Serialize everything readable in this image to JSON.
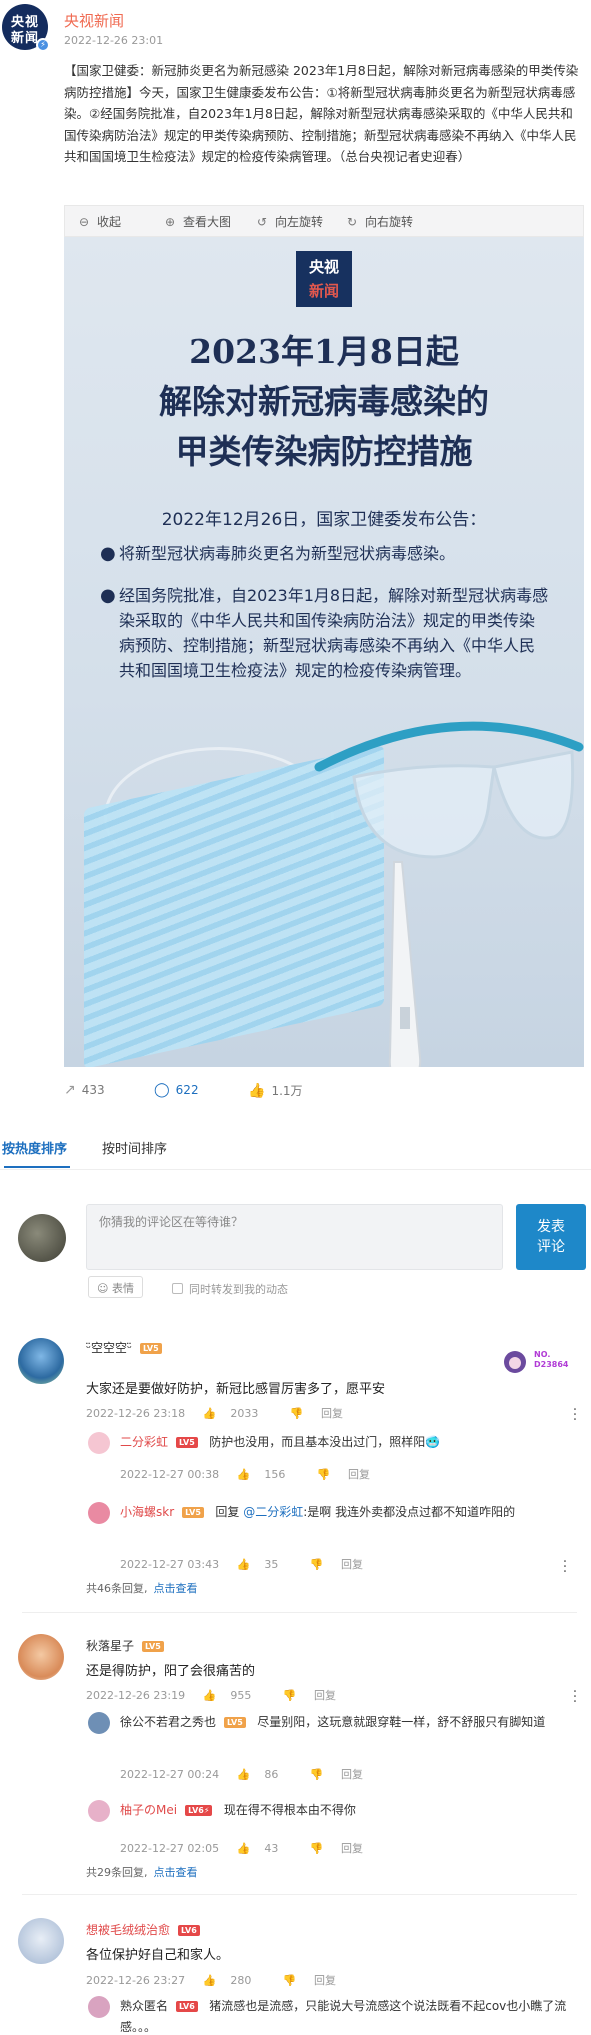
{
  "post": {
    "avatar_text_1": "央视",
    "avatar_text_2": "新闻",
    "author": "央视新闻",
    "time": "2022-12-26 23:01",
    "text": "【国家卫健委：新冠肺炎更名为新冠感染 2023年1月8日起，解除对新冠病毒感染的甲类传染病防控措施】今天，国家卫生健康委发布公告：①将新型冠状病毒肺炎更名为新型冠状病毒感染。②经国务院批准，自2023年1月8日起，解除对新型冠状病毒感染采取的《中华人民共和国传染病防治法》规定的甲类传染病预防、控制措施；新型冠状病毒感染不再纳入《中华人民共和国国境卫生检疫法》规定的检疫传染病管理。（总台央视记者史迎春）"
  },
  "viewer": {
    "collapse": "收起",
    "view_large": "查看大图",
    "rotate_left": "向左旋转",
    "rotate_right": "向右旋转"
  },
  "poster": {
    "logo_1": "央视",
    "logo_2": "新闻",
    "title_1": "2023年1月8日起",
    "title_2": "解除对新冠病毒感染的",
    "title_3": "甲类传染病防控措施",
    "subtitle": "2022年12月26日，国家卫健委发布公告：",
    "bullet_1": "将新型冠状病毒肺炎更名为新型冠状病毒感染。",
    "bullet_2": "经国务院批准，自2023年1月8日起，解除对新型冠状病毒感染采取的《中华人民共和国传染病防治法》规定的甲类传染病预防、控制措施；新型冠状病毒感染不再纳入《中华人民共和国国境卫生检疫法》规定的检疫传染病管理。"
  },
  "actions": {
    "reposts": "433",
    "comments": "622",
    "likes": "1.1万"
  },
  "sort": {
    "hot": "按热度排序",
    "time": "按时间排序"
  },
  "compose": {
    "placeholder": "你猜我的评论区在等待谁？",
    "post_line1": "发表",
    "post_line2": "评论",
    "emoji": "表情",
    "repost": "同时转发到我的动态"
  },
  "comments": [
    {
      "user": "ᵕ̈空空空ᵕ̈",
      "level": "LV5",
      "fan_badge": "NO.\nD23864",
      "text": "大家还是要做好防护，新冠比感冒厉害多了，愿平安",
      "time": "2022-12-26 23:18",
      "likes": "2033",
      "reply": "回复",
      "replies": [
        {
          "user": "二分彩虹",
          "level": "LV5",
          "text": "防护也没用，而且基本没出过门，照样阳🥶",
          "time": "2022-12-27 00:38",
          "likes": "156",
          "reply": "回复"
        },
        {
          "user": "小海螺skr",
          "level": "LV5",
          "reply_prefix": "回复",
          "mention": "@二分彩虹",
          "text": ":是啊  我连外卖都没点过都不知道咋阳的",
          "time": "2022-12-27 03:43",
          "likes": "35",
          "reply": "回复"
        }
      ],
      "more_count": "共46条回复,",
      "more_link": "点击查看"
    },
    {
      "user": "秋落星子",
      "level": "LV5",
      "text": "还是得防护，阳了会很痛苦的",
      "time": "2022-12-26 23:19",
      "likes": "955",
      "reply": "回复",
      "replies": [
        {
          "user": "徐公不若君之秀也",
          "level": "LV5",
          "text": "尽量别阳，这玩意就跟穿鞋一样，舒不舒服只有脚知道",
          "time": "2022-12-27 00:24",
          "likes": "86",
          "reply": "回复"
        },
        {
          "user": "柚子のMei",
          "level": "LV6⚡",
          "text": "现在得不得根本由不得你",
          "time": "2022-12-27 02:05",
          "likes": "43",
          "reply": "回复"
        }
      ],
      "more_count": "共29条回复,",
      "more_link": "点击查看"
    },
    {
      "user": "想被毛绒绒治愈",
      "level": "LV6",
      "text": "各位保护好自己和家人。",
      "time": "2022-12-26 23:27",
      "likes": "280",
      "reply": "回复",
      "replies": [
        {
          "user": "熟众匿名",
          "level": "LV6",
          "text": "猪流感也是流感，只能说大号流感这个说法既看不起cov也小瞧了流感。。。",
          "time": "",
          "likes": "",
          "reply": ""
        }
      ]
    }
  ],
  "colors": {
    "accent": "#1d6fbf",
    "author": "#f06a51",
    "post_button": "#1e88c9"
  }
}
